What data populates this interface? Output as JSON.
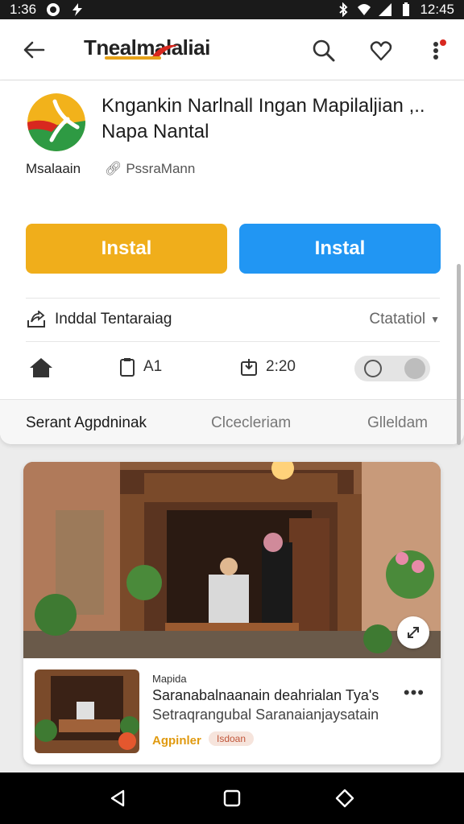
{
  "status_bar": {
    "time_left": "1:36",
    "time_right": "12:45"
  },
  "app_bar": {
    "brand": "Tnealmalaliai"
  },
  "app": {
    "title_line1": "Kngankin Narlnall Ingan Mapilaljian ,..",
    "title_line2": "Napa Nantal",
    "developer": "Msalaain",
    "publisher": "PssraMann",
    "primary_button": "Instal",
    "secondary_button": "Instal",
    "info_label": "Inddal Tentaraiag",
    "info_value": "Ctatatiol",
    "stat_files": "A1",
    "stat_time": "2:20"
  },
  "tabs": [
    {
      "label": "Serant Agpdninak"
    },
    {
      "label": "Clcecleriam"
    },
    {
      "label": "Glleldam"
    }
  ],
  "media": {
    "kicker": "Mapida",
    "title": "Saranabalnaanain deahrialan Tya's",
    "subtitle": "Setraqrangubal Saranaianjaysatain",
    "author": "Agpinler",
    "chip": "Isdoan"
  },
  "colors": {
    "accent_yellow": "#f0ae1b",
    "accent_blue": "#2196f3"
  }
}
